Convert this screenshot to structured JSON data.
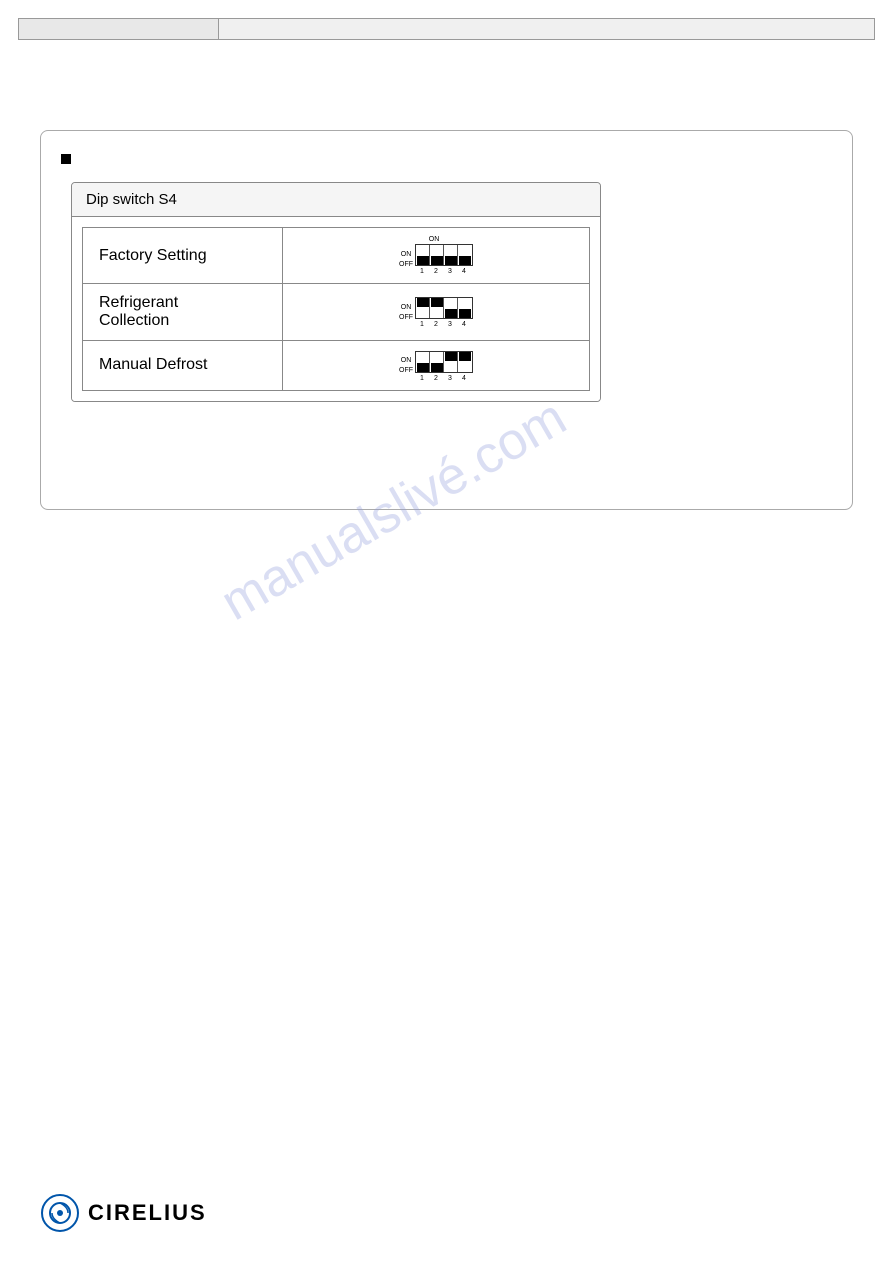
{
  "header": {
    "left_label": "",
    "right_label": ""
  },
  "main_box": {
    "bullet_text": "■",
    "dip_switch": {
      "title": "Dip switch S4",
      "rows": [
        {
          "label": "Factory Setting",
          "switches": [
            false,
            false,
            false,
            false
          ]
        },
        {
          "label_line1": "Refrigerant",
          "label_line2": "Collection",
          "switches": [
            false,
            false,
            false,
            false
          ]
        },
        {
          "label": "Manual Defrost",
          "switches": [
            false,
            false,
            true,
            false
          ]
        }
      ]
    }
  },
  "watermark": {
    "text": "manualslivé.com"
  },
  "footer": {
    "logo_text": "CIRELIUS"
  }
}
